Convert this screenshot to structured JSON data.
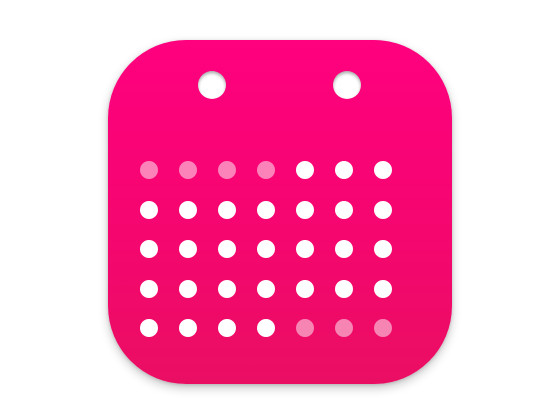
{
  "app_icon": {
    "name": "calendar-app-icon",
    "colors": {
      "gradient_top": "#ff007f",
      "gradient_bottom": "#ea0e63",
      "dot": "#ffffff",
      "dot_faded": "rgba(255,255,255,0.5)"
    },
    "binder_holes": 2,
    "grid": {
      "rows": [
        [
          "faded",
          "faded",
          "faded",
          "faded",
          "full",
          "full",
          "full"
        ],
        [
          "full",
          "full",
          "full",
          "full",
          "full",
          "full",
          "full"
        ],
        [
          "full",
          "full",
          "full",
          "full",
          "full",
          "full",
          "full"
        ],
        [
          "full",
          "full",
          "full",
          "full",
          "full",
          "full",
          "full"
        ],
        [
          "full",
          "full",
          "full",
          "full",
          "faded",
          "faded",
          "faded"
        ]
      ]
    }
  }
}
